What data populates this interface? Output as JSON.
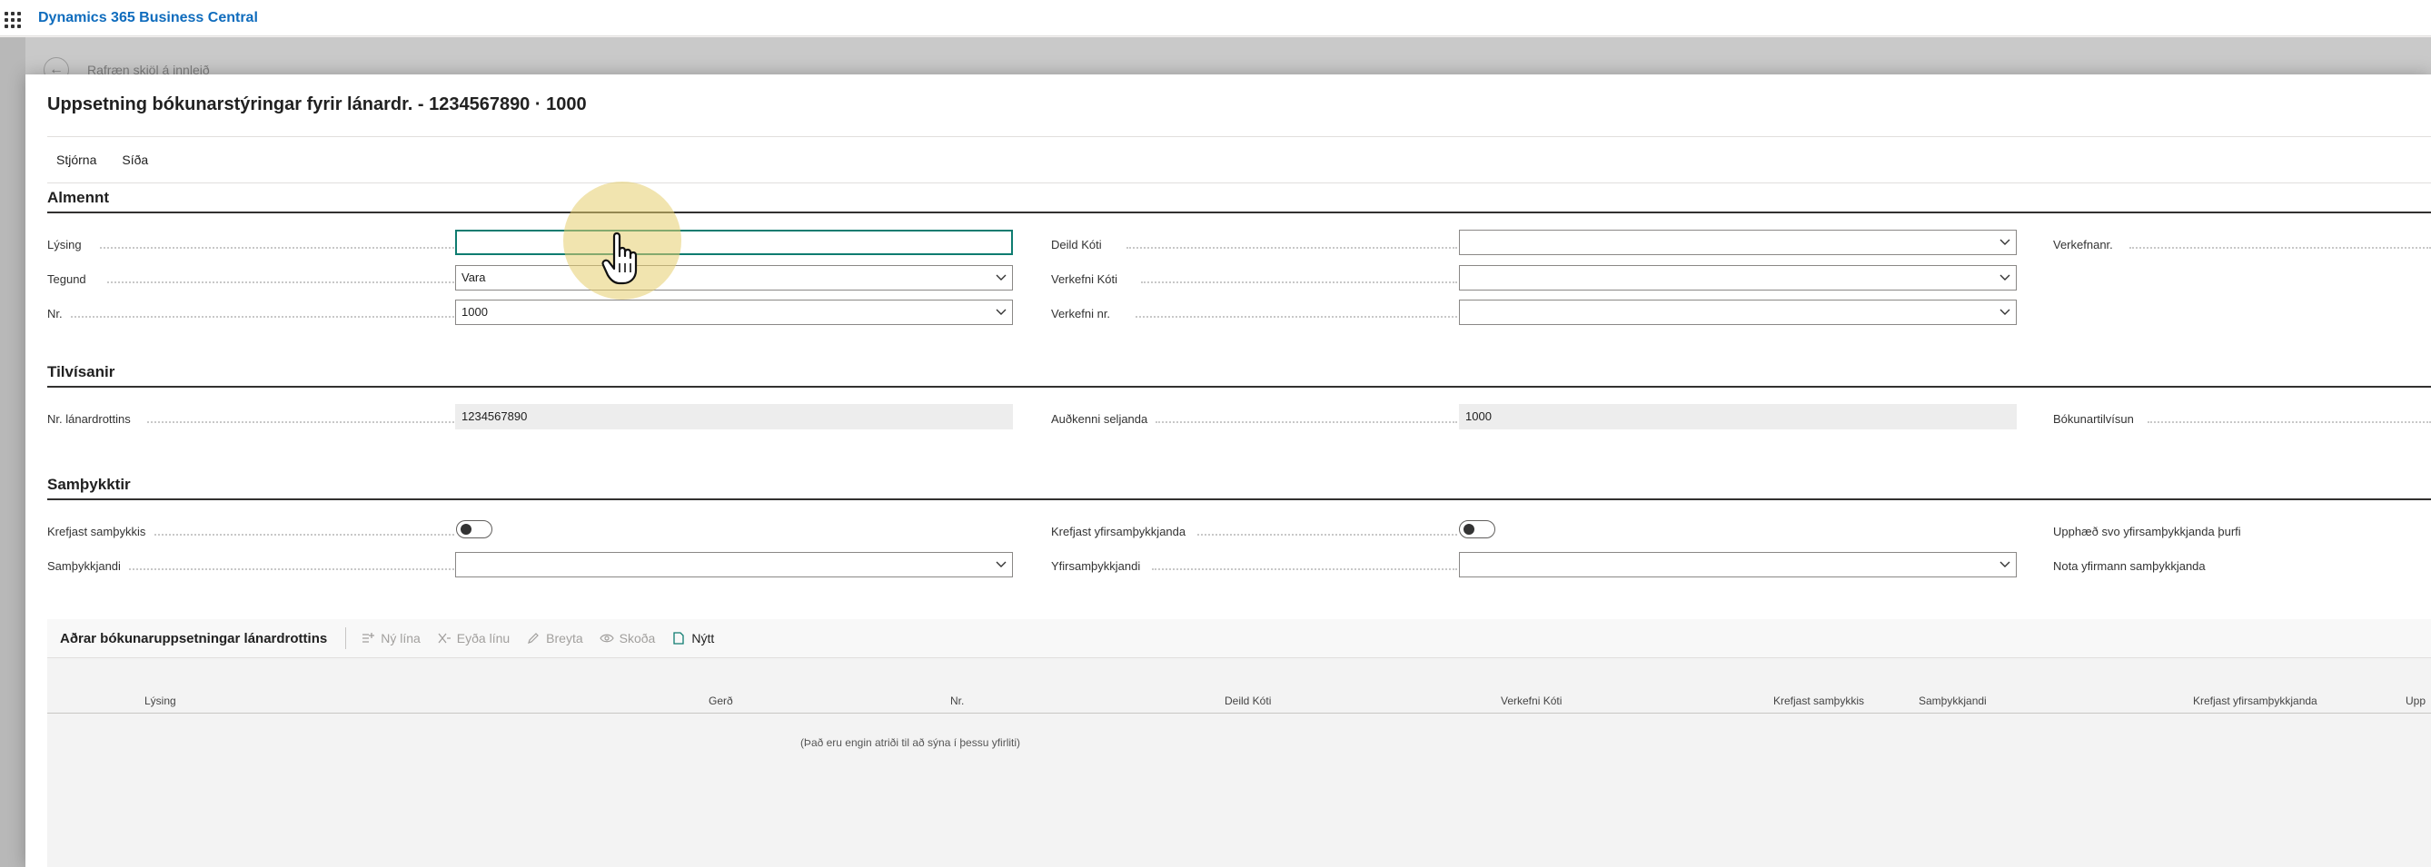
{
  "app": {
    "name": "Dynamics 365 Business Central"
  },
  "background_page": {
    "title": "Rafræn skjöl á innleið"
  },
  "dialog": {
    "title": "Uppsetning bókunarstýringar fyrir lánardr. - 1234567890 · 1000",
    "actions": [
      "Stjórna",
      "Síða"
    ]
  },
  "sections": {
    "general": {
      "heading": "Almennt",
      "description_label": "Lýsing",
      "description_value": "",
      "type_label": "Tegund",
      "type_value": "Vara",
      "no_label": "Nr.",
      "no_value": "1000",
      "dept_code_label": "Deild Kóti",
      "dept_code_value": "",
      "project_code_label": "Verkefni Kóti",
      "project_code_value": "",
      "project_no_label": "Verkefni nr.",
      "project_no_value": "",
      "task_no_label": "Verkefnanr."
    },
    "references": {
      "heading": "Tilvísanir",
      "vendor_no_label": "Nr. lánardrottins",
      "vendor_no_value": "1234567890",
      "seller_id_label": "Auðkenni seljanda",
      "seller_id_value": "1000",
      "posting_ref_label": "Bókunartilvísun"
    },
    "approvals": {
      "heading": "Samþykktir",
      "require_approval_label": "Krefjast samþykkis",
      "require_approval_value": false,
      "require_super_label": "Krefjast yfirsamþykkjanda",
      "require_super_value": false,
      "amount_super_label": "Upphæð svo yfirsamþykkjanda þurfi",
      "approver_label": "Samþykkjandi",
      "approver_value": "",
      "super_approver_label": "Yfirsamþykkjandi",
      "super_approver_value": "",
      "use_manager_label": "Nota yfirmann samþykkjanda"
    }
  },
  "subpart": {
    "title": "Aðrar bókunaruppsetningar lánardrottins",
    "toolbar": {
      "new_line": "Ný lína",
      "delete_line": "Eyða línu",
      "edit": "Breyta",
      "view": "Skoða",
      "new": "Nýtt"
    },
    "columns": [
      "Lýsing",
      "Gerð",
      "Nr.",
      "Deild Kóti",
      "Verkefni Kóti",
      "Krefjast samþykkis",
      "Samþykkjandi",
      "Krefjast yfirsamþykkjanda",
      "Upp"
    ],
    "empty_message": "(Það eru engin atriði til að sýna í þessu yfirliti)"
  },
  "colors": {
    "accent": "#0f6cbd",
    "focus": "#0e7c70",
    "cursor_highlight": "#e6cd6e"
  },
  "icons": [
    "app-launcher-icon",
    "back-arrow-icon",
    "chevron-down-icon",
    "new-line-icon",
    "delete-line-icon",
    "edit-icon",
    "view-icon",
    "new-icon",
    "pointer-hand-icon"
  ]
}
